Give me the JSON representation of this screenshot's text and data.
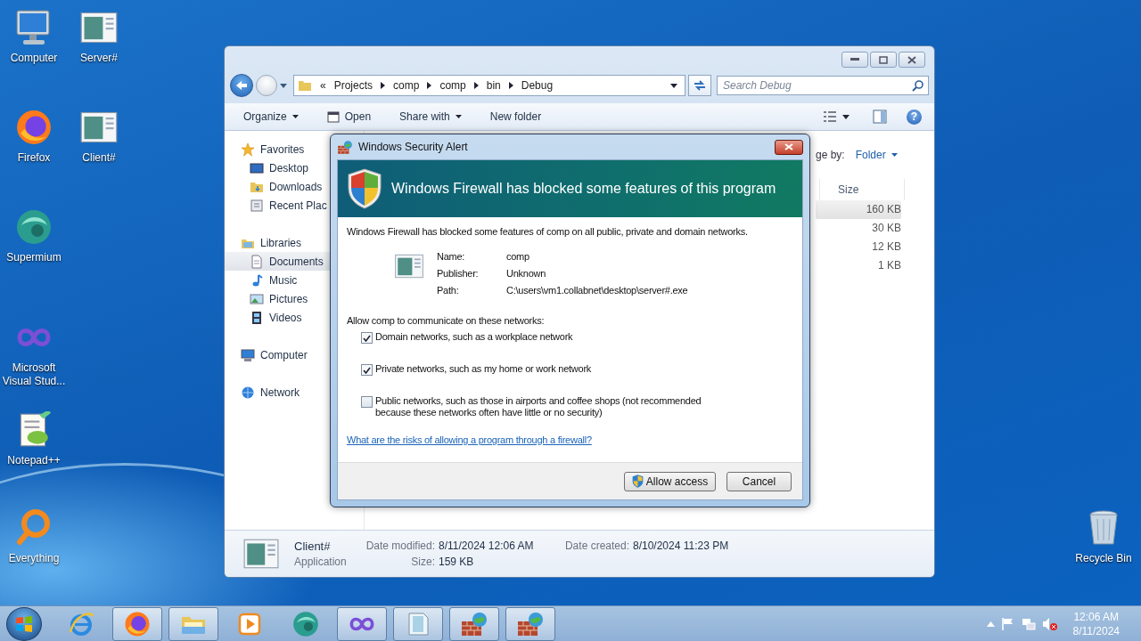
{
  "desktop_icons": [
    {
      "label": "Computer"
    },
    {
      "label": "Server#"
    },
    {
      "label": "Firefox"
    },
    {
      "label": "Client#"
    },
    {
      "label": "Supermium"
    },
    {
      "label": "Microsoft Visual Stud..."
    },
    {
      "label": "Notepad++"
    },
    {
      "label": "Everything"
    },
    {
      "label": "Recycle Bin"
    }
  ],
  "explorer": {
    "address": {
      "overflow_marker": "«",
      "path": [
        "Projects",
        "comp",
        "comp",
        "bin",
        "Debug"
      ]
    },
    "search": {
      "placeholder": "Search Debug"
    },
    "toolbar": [
      {
        "label": "Organize",
        "kind": "menu"
      },
      {
        "label": "Open",
        "kind": "icon"
      },
      {
        "label": "Share with",
        "kind": "menu"
      },
      {
        "label": "New folder",
        "kind": "plain"
      }
    ],
    "help": "?",
    "nav": [
      {
        "label": "Favorites",
        "children": [
          {
            "label": "Desktop",
            "selected": false
          },
          {
            "label": "Downloads",
            "selected": false
          },
          {
            "label": "Recent Plac",
            "selected": false
          }
        ]
      },
      {
        "label": "Libraries",
        "children": [
          {
            "label": "Documents",
            "selected": true
          },
          {
            "label": "Music",
            "selected": false
          },
          {
            "label": "Pictures",
            "selected": false
          },
          {
            "label": "Videos",
            "selected": false
          }
        ]
      },
      {
        "label": "Computer"
      },
      {
        "label": "Network"
      }
    ],
    "arrange": {
      "label": "ge by:",
      "value": "Folder"
    },
    "columns": [
      "Size"
    ],
    "rows": [
      {
        "size": "160 KB",
        "selected": true
      },
      {
        "size": "30 KB",
        "selected": false
      },
      {
        "size": "12 KB",
        "selected": false
      },
      {
        "size": "1 KB",
        "selected": false
      }
    ],
    "details": {
      "name": "Client#",
      "type": "Application",
      "fields": [
        {
          "label": "Date modified:",
          "value": "8/11/2024 12:06 AM"
        },
        {
          "label": "Date created:",
          "value": "8/10/2024 11:23 PM"
        },
        {
          "label": "Size:",
          "value": "159 KB"
        }
      ]
    }
  },
  "dialog": {
    "title": "Windows Security Alert",
    "heading": "Windows Firewall has blocked some features of this program",
    "message": "Windows Firewall has blocked some features of comp on all public, private and domain networks.",
    "info": [
      {
        "label": "Name:",
        "value": "comp"
      },
      {
        "label": "Publisher:",
        "value": "Unknown"
      },
      {
        "label": "Path:",
        "value": "C:\\users\\vm1.collabnet\\desktop\\server#.exe"
      }
    ],
    "networks_label": "Allow comp to communicate on these networks:",
    "networks": [
      {
        "label": "Domain networks, such as a workplace network",
        "checked": true
      },
      {
        "label": "Private networks, such as my home or work network",
        "checked": true
      },
      {
        "label": "Public networks, such as those in airports and coffee shops (not recommended because these networks often have little or no security)",
        "checked": false
      }
    ],
    "link": "What are the risks of allowing a program through a firewall?",
    "buttons": [
      {
        "label": "Allow access",
        "kind": "shield"
      },
      {
        "label": "Cancel",
        "kind": "plain"
      }
    ]
  },
  "taskbar": {
    "items": [
      {
        "running": false
      },
      {
        "running": true
      },
      {
        "running": true
      },
      {
        "running": false
      },
      {
        "running": false
      },
      {
        "running": true
      },
      {
        "running": true
      },
      {
        "running": true
      },
      {
        "running": true
      }
    ],
    "clock": {
      "time": "12:06 AM",
      "date": "8/11/2024"
    }
  }
}
